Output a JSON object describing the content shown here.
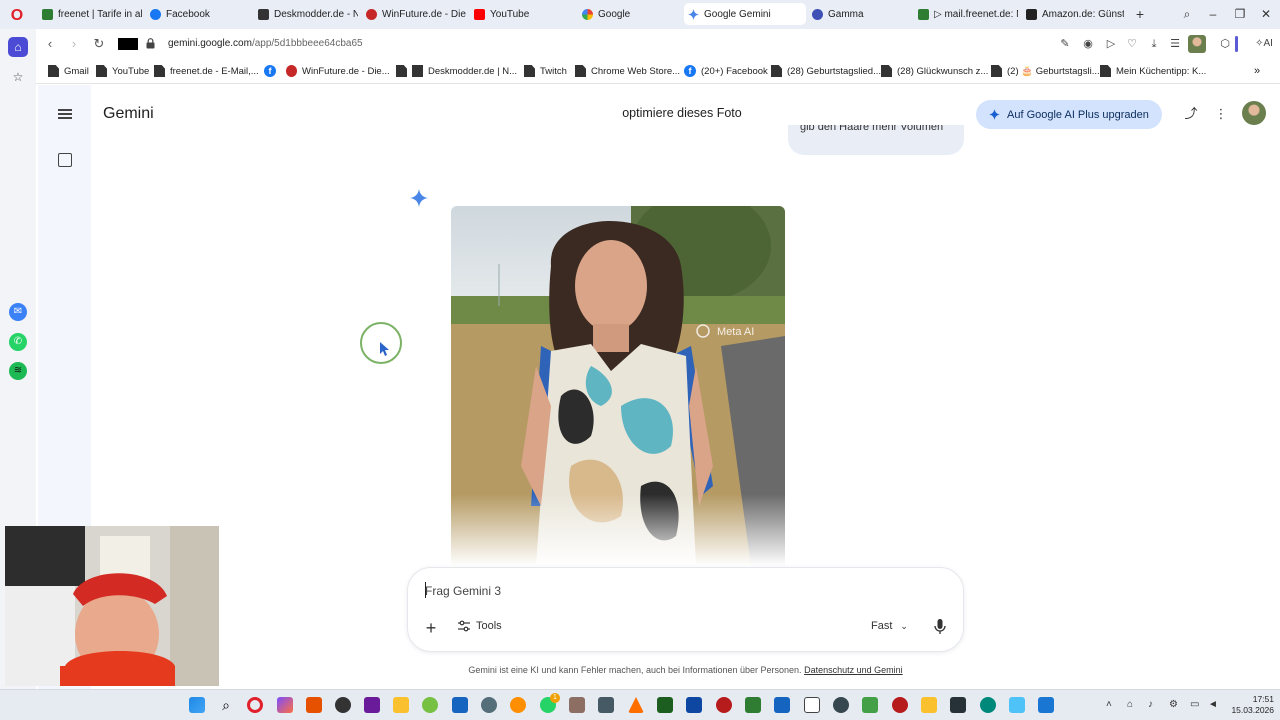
{
  "browser": {
    "tabs": [
      {
        "label": "freenet | Tarife in allen",
        "color": "#2e7d32",
        "active": false
      },
      {
        "label": "Facebook",
        "color": "#1877f2",
        "active": false
      },
      {
        "label": "Deskmodder.de - New",
        "color": "#333333",
        "active": false
      },
      {
        "label": "WinFuture.de - Die ga",
        "color": "#c62828",
        "active": false
      },
      {
        "label": "YouTube",
        "color": "#ff0000",
        "active": false
      },
      {
        "label": "Google",
        "color": "#4285f4",
        "active": false
      },
      {
        "label": "Google Gemini",
        "color": "#4a86e8",
        "active": true
      },
      {
        "label": "Gamma",
        "color": "#3f51b5",
        "active": false
      },
      {
        "label": "▷ mail.freenet.de: Na",
        "color": "#2e7d32",
        "active": false
      },
      {
        "label": "Amazon.de: Günstige",
        "color": "#222222",
        "active": false
      }
    ],
    "url_domain": "gemini.google.com",
    "url_path": "/app/5d1bbbeee64cba65",
    "ai_label": "AI",
    "bookmarks": [
      {
        "label": "Gmail",
        "icon": "page"
      },
      {
        "label": "YouTube",
        "icon": "page"
      },
      {
        "label": "freenet.de - E-Mail,...",
        "icon": "page"
      },
      {
        "label": "",
        "icon": "fb"
      },
      {
        "label": "WinFuture.de - Die...",
        "icon": "page"
      },
      {
        "label": "Deskmodder.de | N...",
        "icon": "page"
      },
      {
        "label": "Twitch",
        "icon": "page"
      },
      {
        "label": "Chrome Web Store...",
        "icon": "page"
      },
      {
        "label": "(20+) Facebook",
        "icon": "fb"
      },
      {
        "label": "(28) Geburtstagslied...",
        "icon": "page"
      },
      {
        "label": "(28) Glückwunsch z...",
        "icon": "page"
      },
      {
        "label": "(2) 🎂 Geburtstagsli...",
        "icon": "page"
      },
      {
        "label": "Mein Küchentipp: K...",
        "icon": "page"
      }
    ]
  },
  "gemini": {
    "brand": "Gemini",
    "chat_title": "optimiere dieses Foto",
    "upgrade_label": "Auf Google AI Plus upgraden",
    "prev_message": "gib den Haare mehr Volumen",
    "watermark": "Meta AI",
    "composer_placeholder": "Frag Gemini 3",
    "tools_label": "Tools",
    "mode_label": "Fast",
    "disclaimer": "Gemini ist eine KI und kann Fehler machen, auch bei Informationen über Personen.",
    "disclaimer_link": "Datenschutz und Gemini",
    "accent": "#4a86e8"
  },
  "taskbar": {
    "time": "17:51",
    "date": "15.03.2026",
    "badge": "1"
  }
}
